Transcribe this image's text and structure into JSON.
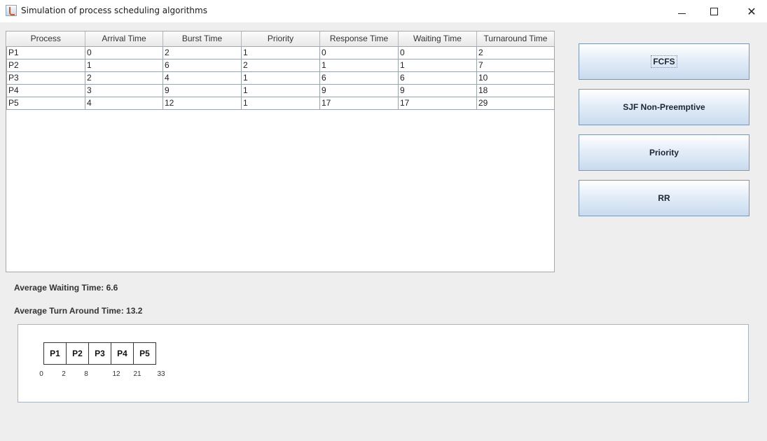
{
  "window": {
    "title": "Simulation of process scheduling algorithms"
  },
  "table": {
    "columns": [
      "Process",
      "Arrival Time",
      "Burst Time",
      "Priority",
      "Response Time",
      "Waiting Time",
      "Turnaround Time"
    ],
    "rows": [
      [
        "P1",
        "0",
        "2",
        "1",
        "0",
        "0",
        "2"
      ],
      [
        "P2",
        "1",
        "6",
        "2",
        "1",
        "1",
        "7"
      ],
      [
        "P3",
        "2",
        "4",
        "1",
        "6",
        "6",
        "10"
      ],
      [
        "P4",
        "3",
        "9",
        "1",
        "9",
        "9",
        "18"
      ],
      [
        "P5",
        "4",
        "12",
        "1",
        "17",
        "17",
        "29"
      ]
    ]
  },
  "buttons": {
    "fcfs": "FCFS",
    "sjf": "SJF Non-Preemptive",
    "priority": "Priority",
    "rr": "RR"
  },
  "averages": {
    "waiting": "Average Waiting Time: 6.6",
    "turnaround": "Average Turn Around Time: 13.2"
  },
  "gantt": {
    "blocks": [
      "P1",
      "P2",
      "P3",
      "P4",
      "P5"
    ],
    "ticks": [
      "0",
      "2",
      "8",
      "12",
      "21",
      "33"
    ]
  }
}
